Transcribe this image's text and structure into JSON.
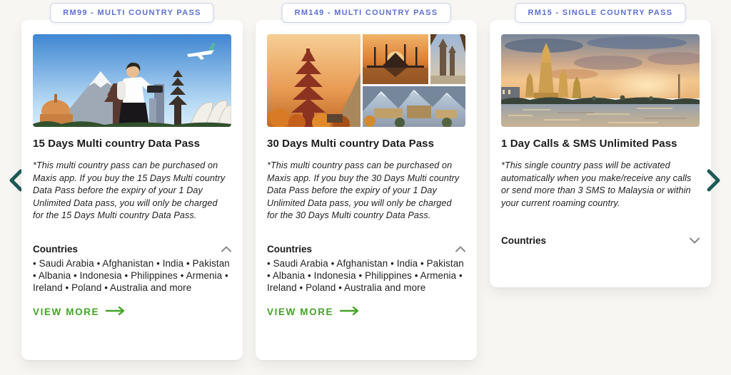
{
  "page": {
    "background": "#f7f6f3"
  },
  "colors": {
    "badge_blue": "#5b6fd6",
    "badge_border": "#c9d1ec",
    "link_green": "#43a524",
    "nav_teal": "#1d5a58",
    "chevron_gray": "#8a8a8a"
  },
  "carousel": {
    "prev_icon": "chevron-left",
    "next_icon": "chevron-right"
  },
  "cards": [
    {
      "badge": "RM99 - MULTI COUNTRY PASS",
      "title": "15 Days Multi country Data Pass",
      "description": "*This multi country pass can be purchased on Maxis app. If you buy the 15 Days Multi country Data Pass before the expiry of your 1 Day Unlimited Data pass, you will only be charged for the 15 Days Multi country Data Pass.",
      "countries_label": "Countries",
      "countries_expanded": true,
      "countries_list": "• Saudi Arabia • Afghanistan • India • Pakistan • Albania • Indonesia • Philippines • Armenia • Ireland • Poland • Australia and more",
      "view_more_label": "VIEW MORE",
      "image_alt": "Traveller with world landmarks, Mount Fuji, pagoda, Sydney Opera House and airplane"
    },
    {
      "badge": "RM149 - MULTI COUNTRY PASS",
      "title": "30 Days Multi country Data Pass",
      "description": "*This multi country pass can be purchased on Maxis app. If you buy the 30 Days Multi country Data Pass before the expiry of your 1 Day Unlimited Data pass, you will only be charged for the 30 Days Multi country Data Pass.",
      "countries_label": "Countries",
      "countries_expanded": true,
      "countries_list": "• Saudi Arabia • Afghanistan • India • Pakistan • Albania • Indonesia • Philippines • Armenia • Ireland • Poland • Australia and more",
      "view_more_label": "VIEW MORE",
      "image_alt": "Collage of autumn pagoda, sunset mosque, church tower and snowy mountains"
    },
    {
      "badge": "RM15 - SINGLE COUNTRY PASS",
      "title": "1 Day Calls & SMS Unlimited Pass",
      "description": "*This single country pass will be activated automatically when you make/receive any calls or send more than 3 SMS to Malaysia or within your current roaming country.",
      "countries_label": "Countries",
      "countries_expanded": false,
      "image_alt": "Wat Arun temple at sunset by the river"
    }
  ]
}
